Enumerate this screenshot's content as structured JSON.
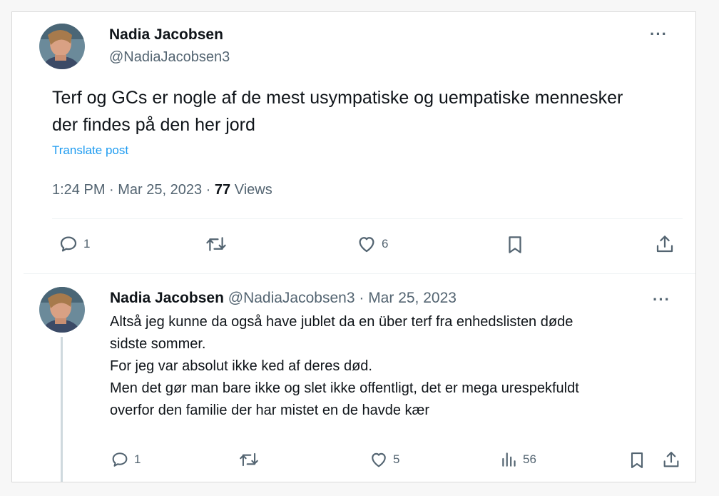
{
  "main_tweet": {
    "name": "Nadia Jacobsen",
    "handle": "@NadiaJacobsen3",
    "more": "···",
    "text_lines": [
      "Terf og GCs er nogle af de mest usympatiske og uempatiske mennesker",
      "der findes på den her jord"
    ],
    "translate": "Translate post",
    "time": "1:24 PM",
    "sep1": " · ",
    "date": "Mar 25, 2023",
    "sep2": " · ",
    "views_count": "77",
    "views_label": " Views",
    "actions": {
      "reply_count": "1",
      "like_count": "6"
    }
  },
  "reply": {
    "name": "Nadia Jacobsen",
    "handle": "@NadiaJacobsen3",
    "dot": " · ",
    "date": "Mar 25, 2023",
    "more": "···",
    "text_lines": [
      "Altså jeg kunne da også have jublet da en über terf fra enhedslisten døde",
      "sidste sommer.",
      "For jeg var absolut ikke ked af deres død.",
      "Men det gør man bare ikke og slet ikke offentligt, det er mega urespekfuldt",
      "overfor den familie der har mistet en de havde kær"
    ],
    "actions": {
      "reply_count": "1",
      "like_count": "5",
      "views_count": "56"
    }
  },
  "icons": {
    "reply": "speech-bubble-icon",
    "retweet": "retweet-icon",
    "like": "heart-icon",
    "bookmark": "bookmark-icon",
    "share": "share-icon",
    "views": "bar-chart-icon"
  },
  "colors": {
    "text": "#0f1419",
    "secondary": "#536471",
    "link": "#1d9bf0",
    "border": "#eff3f4"
  }
}
